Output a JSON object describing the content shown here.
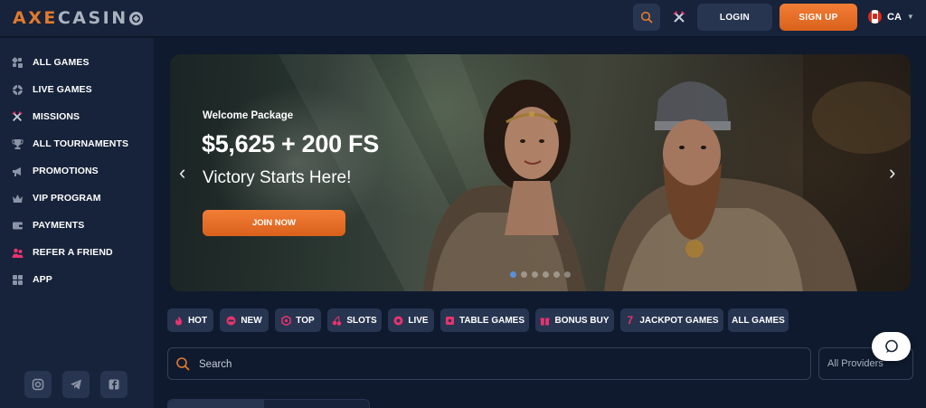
{
  "header": {
    "logo": {
      "axe": "AXE",
      "casino": "CASIN"
    },
    "login_label": "LOGIN",
    "signup_label": "SIGN UP",
    "lang": "CA",
    "icons": {
      "search": "search-icon",
      "missions": "crossed-axes-icon",
      "flag": "canada-flag-icon"
    }
  },
  "sidebar": {
    "items": [
      {
        "label": "ALL GAMES",
        "icon": "dice-icon"
      },
      {
        "label": "LIVE GAMES",
        "icon": "roulette-icon"
      },
      {
        "label": "MISSIONS",
        "icon": "crossed-axes-icon"
      },
      {
        "label": "ALL TOURNAMENTS",
        "icon": "trophy-icon"
      },
      {
        "label": "PROMOTIONS",
        "icon": "megaphone-icon"
      },
      {
        "label": "VIP PROGRAM",
        "icon": "crown-icon"
      },
      {
        "label": "PAYMENTS",
        "icon": "wallet-icon"
      },
      {
        "label": "REFER A FRIEND",
        "icon": "users-icon"
      },
      {
        "label": "APP",
        "icon": "apps-grid-icon"
      }
    ],
    "socials": [
      "instagram-icon",
      "telegram-icon",
      "facebook-icon"
    ]
  },
  "banner": {
    "kicker": "Welcome Package",
    "amount": "$5,625 + 200 FS",
    "tagline": "Victory Starts Here!",
    "cta": "JOIN NOW",
    "slides": 6,
    "active_slide": 1
  },
  "categories": [
    {
      "label": "HOT",
      "icon": "fire-icon"
    },
    {
      "label": "NEW",
      "icon": "new-badge-icon"
    },
    {
      "label": "TOP",
      "icon": "top-badge-icon"
    },
    {
      "label": "SLOTS",
      "icon": "cherries-icon"
    },
    {
      "label": "LIVE",
      "icon": "roulette-icon"
    },
    {
      "label": "TABLE GAMES",
      "icon": "cards-icon"
    },
    {
      "label": "BONUS BUY",
      "icon": "gift-icon"
    },
    {
      "label": "JACKPOT GAMES",
      "icon": "seven-icon"
    },
    {
      "label": "ALL GAMES",
      "icon": ""
    }
  ],
  "search": {
    "placeholder": "Search"
  },
  "providers": {
    "selected": "All Providers"
  },
  "colors": {
    "accent": "#e07a2e",
    "background": "#0f1a2e",
    "panel": "#17233a",
    "chip": "#273551",
    "icon_pink": "#e8336e"
  }
}
